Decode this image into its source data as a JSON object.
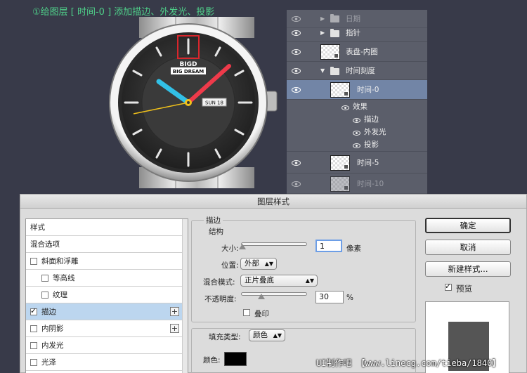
{
  "caption": "①给图层 [ 时间-0 ] 添加描边、外发光、投影",
  "watch": {
    "brand": "BIGD",
    "brand_sub": "BIG DREAM",
    "date": "SUN 18"
  },
  "layers": {
    "rows": [
      {
        "name": "日期",
        "kind": "folder"
      },
      {
        "name": "指针",
        "kind": "folder"
      },
      {
        "name": "表盘-内圈",
        "kind": "layer"
      },
      {
        "name": "时间刻度",
        "kind": "folder-open"
      },
      {
        "name": "时间-0",
        "kind": "layer"
      },
      {
        "name": "效果",
        "kind": "effects"
      },
      {
        "name": "描边",
        "kind": "effect"
      },
      {
        "name": "外发光",
        "kind": "effect"
      },
      {
        "name": "投影",
        "kind": "effect"
      },
      {
        "name": "时间-5",
        "kind": "layer"
      },
      {
        "name": "时间-10",
        "kind": "layer"
      }
    ]
  },
  "dialog": {
    "title": "图层样式",
    "styles_header": "样式",
    "blend_options": "混合选项",
    "style_items": [
      {
        "label": "斜面和浮雕",
        "checked": false
      },
      {
        "label": "等高线",
        "checked": false
      },
      {
        "label": "纹理",
        "checked": false
      },
      {
        "label": "描边",
        "checked": true
      },
      {
        "label": "内阴影",
        "checked": false
      },
      {
        "label": "内发光",
        "checked": false
      },
      {
        "label": "光泽",
        "checked": false
      }
    ],
    "stroke": {
      "section": "描边",
      "structure": "结构",
      "size_label": "大小:",
      "size_value": "1",
      "size_unit": "像素",
      "position_label": "位置:",
      "position_value": "外部",
      "blend_label": "混合模式:",
      "blend_value": "正片叠底",
      "opacity_label": "不透明度:",
      "opacity_value": "30",
      "opacity_unit": "%",
      "overprint_label": "叠印",
      "fill_type_label": "填充类型:",
      "fill_type_value": "颜色",
      "color_label": "颜色:",
      "color_value": "#000000"
    },
    "buttons": {
      "ok": "确定",
      "cancel": "取消",
      "new_style": "新建样式...",
      "preview": "预览"
    }
  },
  "watermark": "UI制作吧 【www.linecg.com/tieba/1840】"
}
